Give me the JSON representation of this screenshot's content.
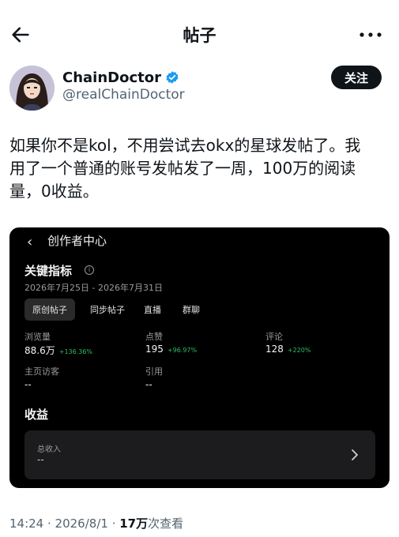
{
  "header": {
    "title": "帖子",
    "back_icon": "arrow-left-icon",
    "more_icon": "more-horizontal-icon"
  },
  "author": {
    "display_name": "ChainDoctor",
    "handle": "@realChainDoctor",
    "verified": true,
    "verified_color": "#1d9bf0",
    "follow_label": "关注"
  },
  "post": {
    "text": "如果你不是kol，不用尝试去okx的星球发帖了。我\n用了一个普通的账号发帖发了一周，100万的阅读\n量，0收益。"
  },
  "embedded_screenshot": {
    "back_glyph": "‹",
    "title": "创作者中心",
    "kpi_heading": "关键指标",
    "info_glyph": "i",
    "date_range": "2026年7月25日 - 2026年7月31日",
    "tabs": [
      {
        "label": "原创帖子",
        "active": true
      },
      {
        "label": "同步帖子",
        "active": false
      },
      {
        "label": "直播",
        "active": false
      },
      {
        "label": "群聊",
        "active": false
      }
    ],
    "metrics": [
      {
        "label": "浏览量",
        "value": "88.6万",
        "delta": "+136.36%"
      },
      {
        "label": "点赞",
        "value": "195",
        "delta": "+96.97%"
      },
      {
        "label": "评论",
        "value": "128",
        "delta": "+220%"
      },
      {
        "label": "主页访客",
        "value": "--",
        "delta": ""
      },
      {
        "label": "引用",
        "value": "--",
        "delta": ""
      }
    ],
    "income_heading": "收益",
    "income_card": {
      "label": "总收入",
      "value": "--"
    },
    "accent_positive": "#2ebd6b"
  },
  "meta": {
    "time": "14:24",
    "separator": " · ",
    "date": "2026/8/1",
    "views_count": "17万",
    "views_label": "次查看"
  }
}
